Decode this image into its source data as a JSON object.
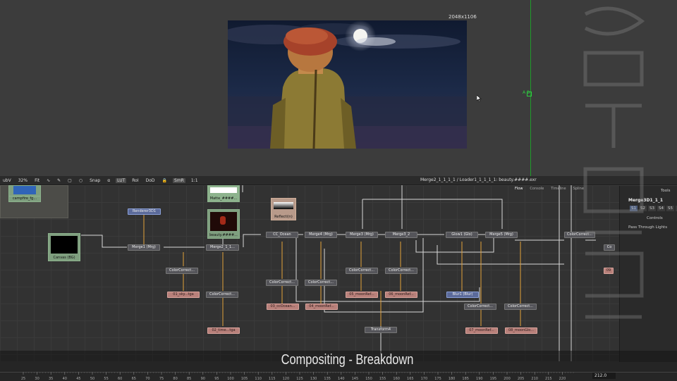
{
  "viewer": {
    "resolution": "2048x1106",
    "gizmo_label": "A B"
  },
  "toolbar": {
    "items": [
      "ubV",
      "32%",
      "Fit",
      "Snap",
      "α",
      "LUT",
      "RoI",
      "DoD",
      "SmR",
      "1:1"
    ],
    "path": "Merge2_1_1_1_1 / Loader1_1_1_1_1: beauty.####.exr"
  },
  "flow_tabs": [
    "Flow",
    "Console",
    "Timeline",
    "Spline"
  ],
  "tools_panel": {
    "header": "Tools",
    "title": "Merge3D1_1_1",
    "tabs": [
      "S1",
      "S2",
      "S3",
      "S4",
      "S5",
      "S6"
    ],
    "controls_label": "Controls",
    "pass_through": "Pass Through Lights"
  },
  "nodes": {
    "campfire": "campfire_fg...",
    "renderer": "Renderer3D1",
    "canvas": "Canvas (BG)",
    "merge1": "Merge1 (Mrg)",
    "matte": "Matte_####...",
    "beauty": "beauty.####...",
    "merge2": "Merge2_1_1...",
    "reflection": "Reflecti(n)",
    "cc_ocean": "CC_Ocean",
    "merge4": "Merge4 (Mrg)",
    "merge3": "Merge3 (Mrg)",
    "merge3_2": "Merge3_2",
    "glow1": "Glow1 (Glo)",
    "merge5": "Merge5 (Mrg)",
    "cc_right": "ColorCorrect...",
    "cc1": "ColorCorrect...",
    "cc2": "ColorCorrect...",
    "cc3": "ColorCorrect...",
    "cc4": "ColorCorrect...",
    "cc5": "ColorCorrect...",
    "cc6": "ColorCorrect...",
    "cc7": "ColorCorrect...",
    "cc8": "ColorCorrect...",
    "cc9": "ColorCorrect...",
    "sky": "01_sky...tga",
    "time": "02_time...tga",
    "cc_ocean_out": "03_ccOcean...",
    "moon_ref4": "04_moonRef...",
    "moon_ref5": "05_moonRef...",
    "moon_ref6": "06_moonRef...",
    "blur": "Blur1 (Blur)",
    "moon_ref7": "07_moonRef...",
    "moon_glow": "08_moonGlo...",
    "transform": "Transform4",
    "right_cc": "Co",
    "right_09": "09"
  },
  "caption": "Compositing - Breakdown",
  "timeline": {
    "ticks": [
      "25",
      "30",
      "35",
      "40",
      "45",
      "50",
      "55",
      "60",
      "65",
      "70",
      "75",
      "80",
      "85",
      "90",
      "95",
      "100",
      "105",
      "110",
      "115",
      "120",
      "125",
      "130",
      "135",
      "140",
      "145",
      "150",
      "155",
      "160",
      "165",
      "170",
      "175",
      "180",
      "185",
      "190",
      "195",
      "200",
      "205",
      "210",
      "215",
      "220"
    ],
    "current_frame": "212.0"
  },
  "colors": {
    "accent_green": "#2ecc40",
    "node_blue": "#5b6a9a",
    "node_pink": "#b8807a"
  }
}
